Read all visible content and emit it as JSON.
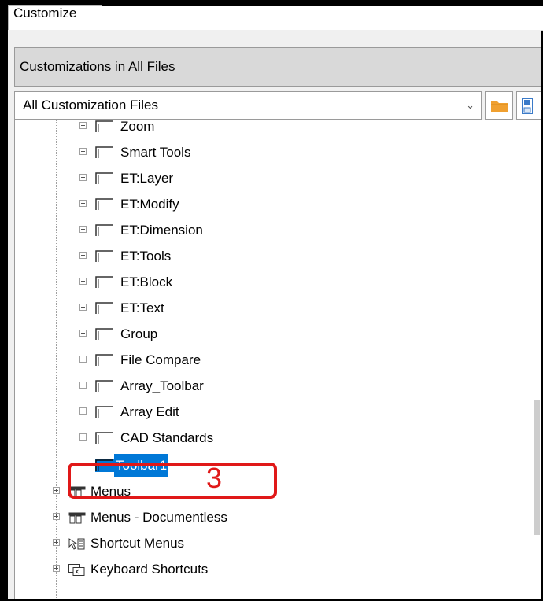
{
  "tab": {
    "label": "Customize"
  },
  "header": {
    "title": "Customizations in All Files"
  },
  "file_combo": {
    "value": "All Customization Files",
    "arrow": "⌄"
  },
  "toolbar_items": [
    {
      "label": "Zoom"
    },
    {
      "label": "Smart Tools"
    },
    {
      "label": "ET:Layer"
    },
    {
      "label": "ET:Modify"
    },
    {
      "label": "ET:Dimension"
    },
    {
      "label": "ET:Tools"
    },
    {
      "label": "ET:Block"
    },
    {
      "label": "ET:Text"
    },
    {
      "label": "Group"
    },
    {
      "label": "File Compare"
    },
    {
      "label": "Array_Toolbar"
    },
    {
      "label": "Array Edit"
    },
    {
      "label": "CAD Standards"
    }
  ],
  "selected_item": {
    "label": "Toolbar1"
  },
  "root_nodes": [
    {
      "label": "Menus",
      "icon": "menus-icon"
    },
    {
      "label": "Menus - Documentless",
      "icon": "menus-icon"
    },
    {
      "label": "Shortcut Menus",
      "icon": "shortcut-menus-icon"
    },
    {
      "label": "Keyboard Shortcuts",
      "icon": "keyboard-shortcuts-icon"
    }
  ],
  "annotation": {
    "number": "3",
    "color": "#e01818"
  },
  "colors": {
    "selection": "#0078d7",
    "annotation": "#e01818",
    "folder": "#f0a030"
  }
}
